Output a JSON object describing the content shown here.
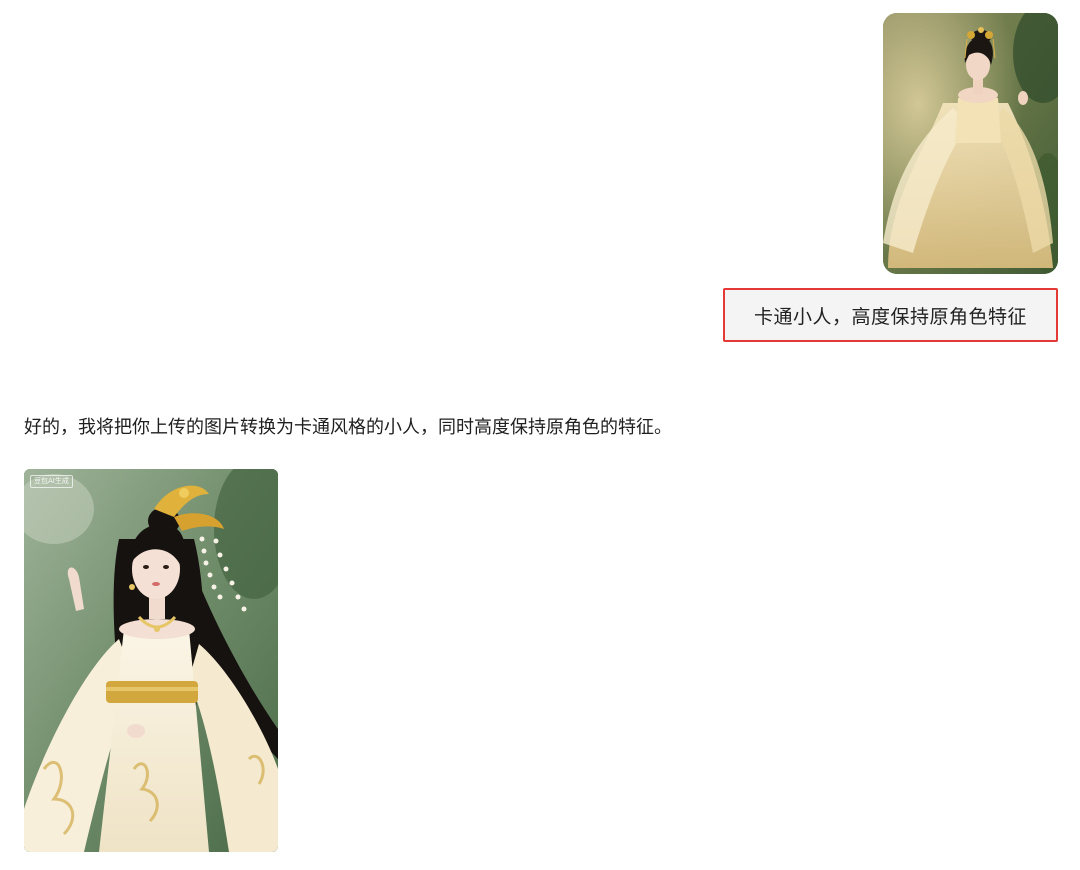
{
  "conversation": {
    "user_message": {
      "image": {
        "subject": "woman-in-hanfu-photo",
        "icon": "photo-thumbnail-icon"
      },
      "text": "卡通小人，高度保持原角色特征",
      "highlight_color": "#e53935"
    },
    "assistant_message": {
      "text": "好的，我将把你上传的图片转换为卡通风格的小人，同时高度保持原角色的特征。",
      "image": {
        "subject": "cartoon-woman-in-hanfu",
        "watermark": "豆包AI生成"
      }
    }
  },
  "colors": {
    "bubble_background": "#f4f4f4",
    "highlight_border": "#e53935",
    "text": "#1f1f1f"
  }
}
